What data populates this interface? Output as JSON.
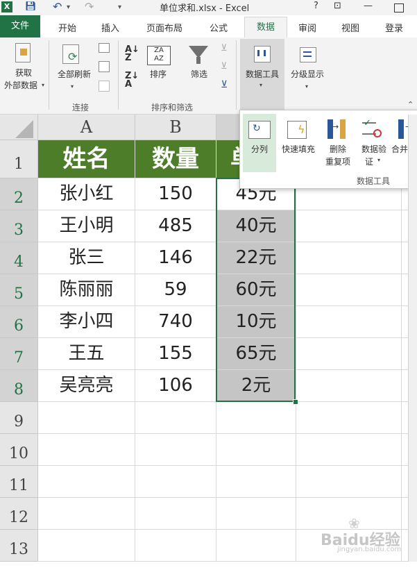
{
  "window": {
    "title": "单位求和.xlsx - Excel",
    "controls": [
      "?",
      "⊡",
      "—"
    ]
  },
  "ribbon_tabs": [
    "文件",
    "开始",
    "插入",
    "页面布局",
    "公式",
    "数据",
    "审阅",
    "视图"
  ],
  "active_tab": "数据",
  "account": "登录",
  "ribbon": {
    "get_external": [
      "获取",
      "外部数据"
    ],
    "refresh_all": "全部刷新",
    "group_connect": "连接",
    "sort": "排序",
    "filter": "筛选",
    "group_sort_filter": "排序和筛选",
    "data_tools": "数据工具",
    "outline": "分级显示"
  },
  "popup": {
    "items": [
      {
        "label": "分列"
      },
      {
        "label": "快速填充"
      },
      {
        "label": "删除",
        "label2": "重复项"
      },
      {
        "label": "数据验",
        "label2": "证"
      },
      {
        "label": "合并计"
      }
    ],
    "group_label": "数据工具"
  },
  "sheet": {
    "columns": [
      "A",
      "B"
    ],
    "row_numbers": [
      "1",
      "2",
      "3",
      "4",
      "5",
      "6",
      "7",
      "8",
      "9",
      "10",
      "11",
      "12",
      "13"
    ],
    "header": {
      "a": "姓名",
      "b": "数量",
      "c": "单"
    },
    "rows": [
      {
        "a": "张小红",
        "b": "150",
        "c": "45元"
      },
      {
        "a": "王小明",
        "b": "485",
        "c": "40元"
      },
      {
        "a": "张三",
        "b": "146",
        "c": "22元"
      },
      {
        "a": "陈丽丽",
        "b": "59",
        "c": "60元"
      },
      {
        "a": "李小四",
        "b": "740",
        "c": "10元"
      },
      {
        "a": "王五",
        "b": "155",
        "c": "65元"
      },
      {
        "a": "吴亮亮",
        "b": "106",
        "c": "2元"
      }
    ]
  },
  "watermark": {
    "text": "Baidu经验",
    "sub": "jingyan.baidu.com"
  },
  "colors": {
    "excel_green": "#217346",
    "header_fill": "#4e7d2a",
    "selection": "#c5c5c5"
  }
}
